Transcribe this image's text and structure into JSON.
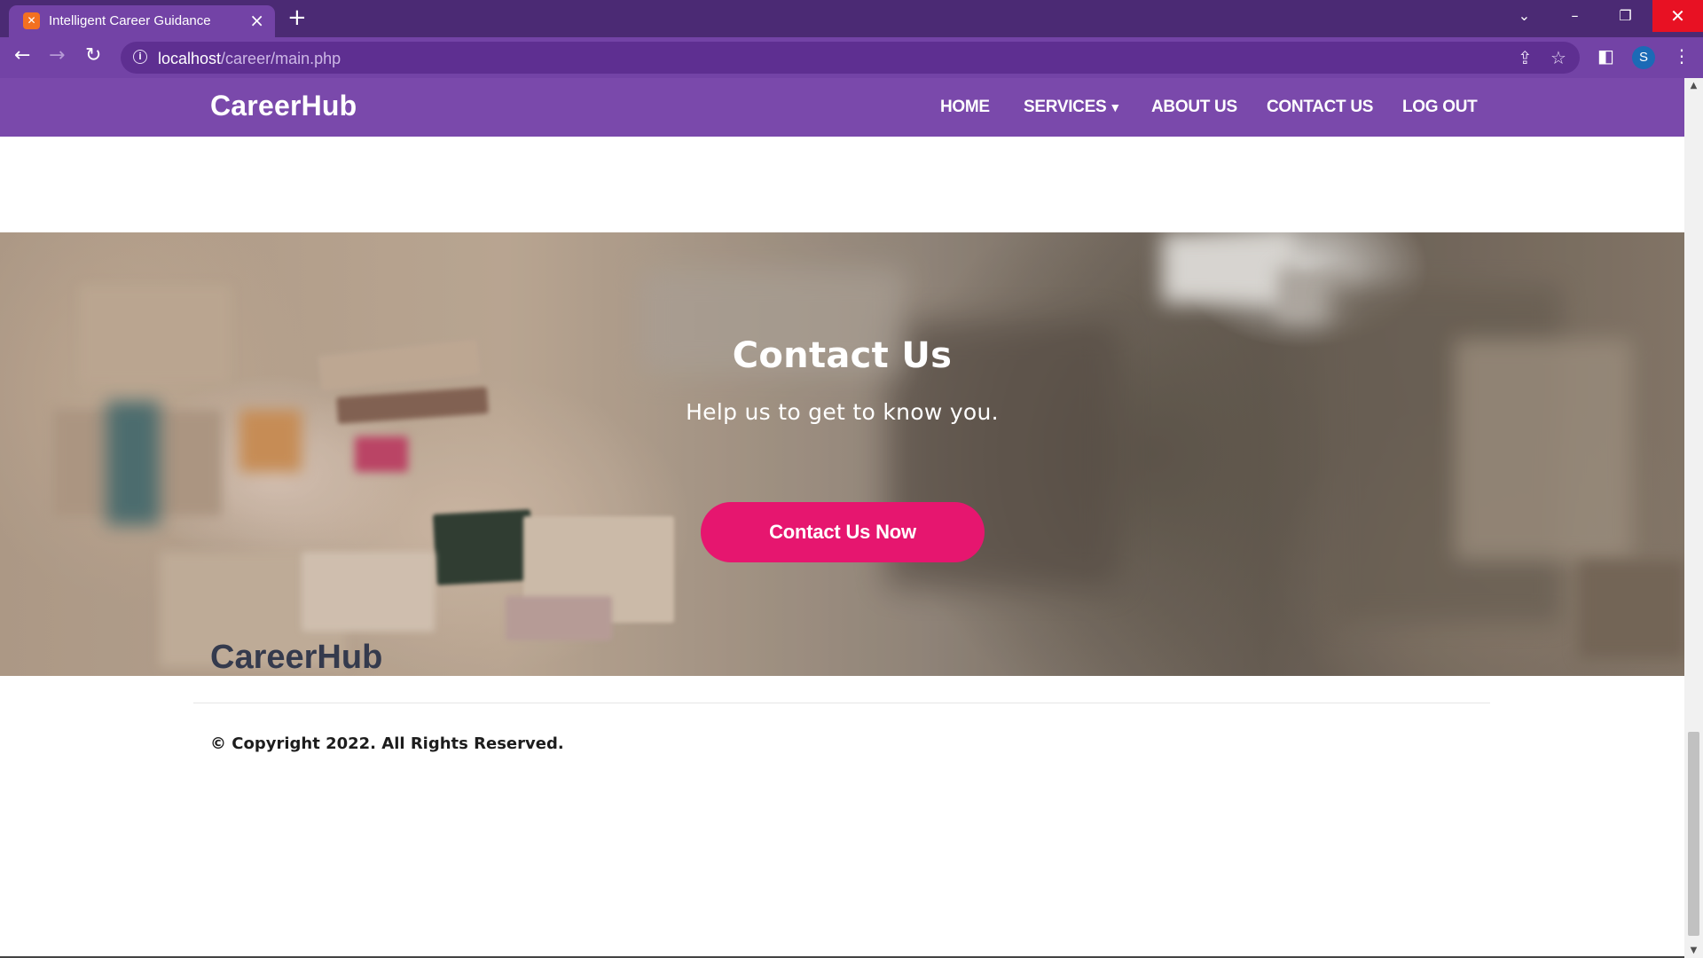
{
  "browser": {
    "tab_title": "Intelligent Career Guidance",
    "tab_favicon": "xampp-icon",
    "url_host": "localhost",
    "url_path": "/career/main.php",
    "profile_initial": "S",
    "colors": {
      "frame": "#4b2a74",
      "toolbar": "#7343a6",
      "omnibox": "#5e2f91",
      "close": "#e81123"
    }
  },
  "site": {
    "brand": "CareerHub",
    "nav": [
      {
        "label": "HOME"
      },
      {
        "label": "SERVICES",
        "has_dropdown": true
      },
      {
        "label": "ABOUT US"
      },
      {
        "label": "CONTACT US"
      },
      {
        "label": "LOG OUT"
      }
    ],
    "colors": {
      "nav_bg": "#7a49ab",
      "cta": "#e6166f",
      "footer_text": "#343a4d"
    }
  },
  "hero": {
    "title": "Contact Us",
    "subtitle": "Help us to get to know you.",
    "button": "Contact Us Now"
  },
  "footer": {
    "brand": "CareerHub",
    "copyright": "© Copyright 2022. All Rights Reserved."
  }
}
